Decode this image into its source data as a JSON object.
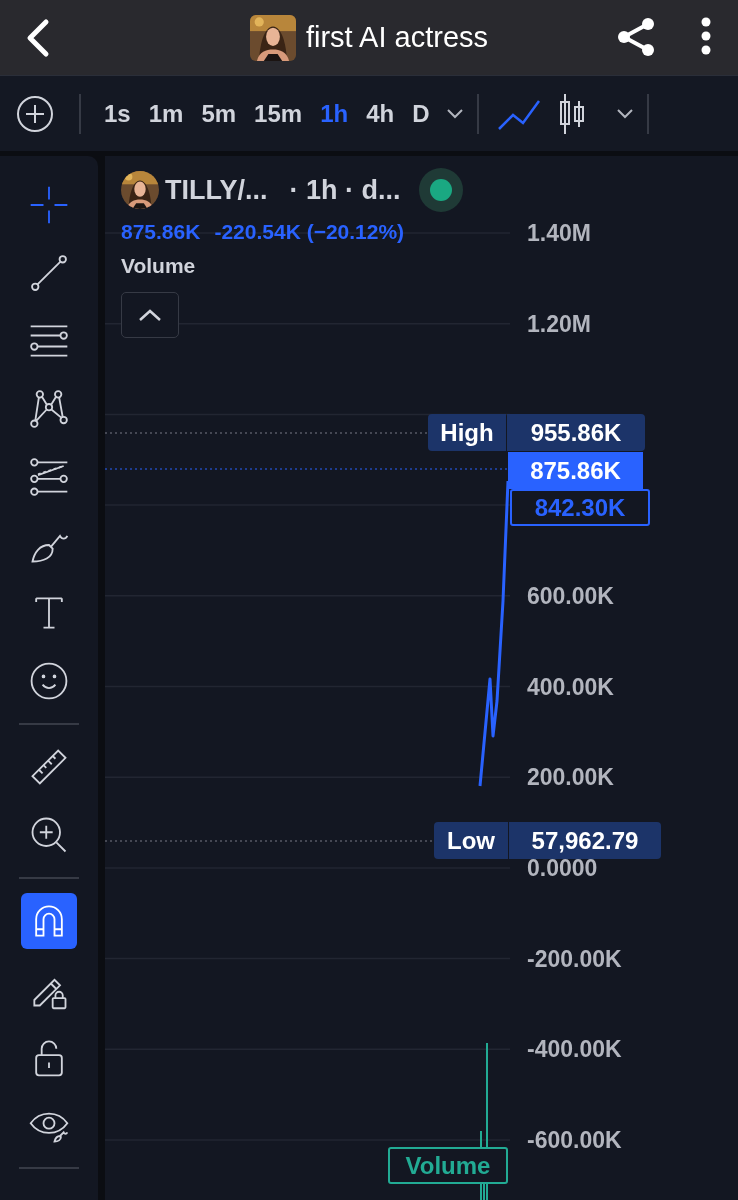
{
  "header": {
    "title": "first AI actress"
  },
  "toolbar": {
    "intervals": [
      {
        "label": "1s",
        "selected": false
      },
      {
        "label": "1m",
        "selected": false
      },
      {
        "label": "5m",
        "selected": false
      },
      {
        "label": "15m",
        "selected": false
      },
      {
        "label": "1h",
        "selected": true
      },
      {
        "label": "4h",
        "selected": false
      },
      {
        "label": "D",
        "selected": false
      }
    ],
    "chart_types": [
      {
        "kind": "line",
        "selected": true
      },
      {
        "kind": "candles",
        "selected": false
      }
    ]
  },
  "tool_groups": [
    {
      "kind": "drawing",
      "tools": [
        {
          "kind": "crosshair",
          "selected": true
        },
        {
          "kind": "trend-line",
          "selected": false
        },
        {
          "kind": "horizontal-lines",
          "selected": false
        },
        {
          "kind": "pattern",
          "selected": false
        },
        {
          "kind": "parallel-lines",
          "selected": false
        },
        {
          "kind": "brush",
          "selected": false
        },
        {
          "kind": "text",
          "selected": false
        },
        {
          "kind": "smiley",
          "selected": false
        }
      ]
    },
    {
      "kind": "measure",
      "tools": [
        {
          "kind": "ruler",
          "selected": false
        },
        {
          "kind": "zoom-in",
          "selected": false
        }
      ]
    },
    {
      "kind": "toggles",
      "tools": [
        {
          "kind": "magnet",
          "selected": true
        },
        {
          "kind": "pencil-lock",
          "selected": false
        },
        {
          "kind": "lock",
          "selected": false
        },
        {
          "kind": "eye",
          "selected": false
        }
      ]
    }
  ],
  "legend": {
    "symbol": "TILLY/...",
    "meta": "· 1h · d...",
    "status": {
      "color": "#1aa882"
    },
    "last": "875.86K",
    "change": "-220.54K",
    "change_pct": "(−20.12%)",
    "indicator": "Volume"
  },
  "price_axis": {
    "labels": [
      "1.40M",
      "1.20M",
      "600.00K",
      "400.00K",
      "200.00K",
      "0.0000",
      "-200.00K",
      "-400.00K",
      "-600.00K"
    ]
  },
  "price_tags": {
    "high_label": "High",
    "high": "955.86K",
    "last": "875.86K",
    "current": "842.30K",
    "low_label": "Low",
    "low": "57,962.79",
    "volume": "Volume"
  }
}
